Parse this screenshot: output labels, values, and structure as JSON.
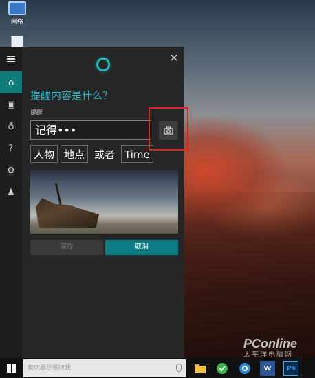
{
  "desktop": {
    "icons": [
      {
        "label": "网络",
        "icon": "network-icon"
      },
      {
        "label": "",
        "icon": "recycle-bin-icon"
      }
    ],
    "watermark": {
      "brand": "PConline",
      "sub": "太平洋电脑网"
    }
  },
  "cortana": {
    "rail": [
      "menu-icon",
      "home-icon",
      "notebook-icon",
      "lightbulb-icon",
      "help-icon",
      "settings-icon",
      "feedback-icon"
    ],
    "question": "提醒内容是什么？",
    "field_label": "提醒",
    "input_value": "记得•••",
    "chips": [
      "人物",
      "地点",
      "或者",
      "Time"
    ],
    "save_label": "保存",
    "cancel_label": "取消",
    "accent_color": "#0d7e85"
  },
  "taskbar": {
    "search_placeholder": "有问题尽管问我",
    "pinned": [
      "file-explorer-icon",
      "browser-icon",
      "ie-icon",
      "word-icon",
      "photoshop-icon"
    ],
    "word_label": "W",
    "ps_label": "Ps"
  }
}
